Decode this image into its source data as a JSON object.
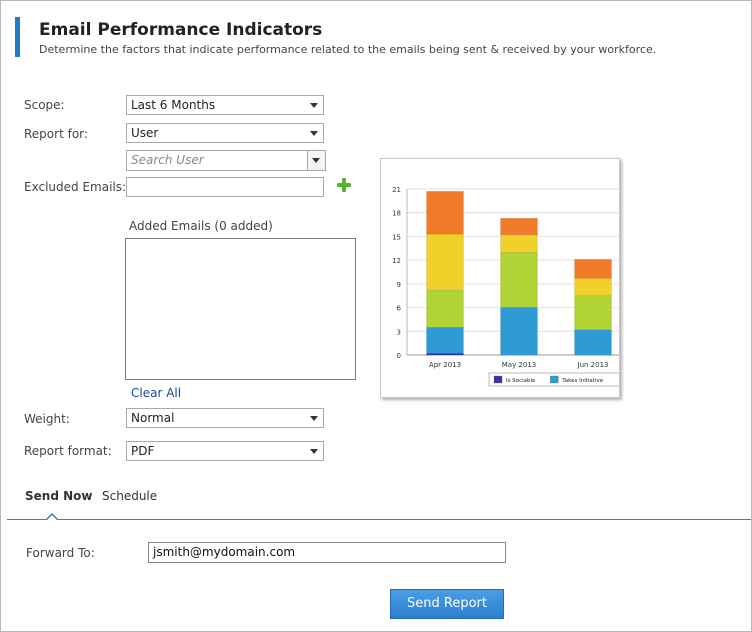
{
  "header": {
    "title": "Email Performance Indicators",
    "subtitle": "Determine the factors that indicate performance related to the emails being sent & received by your workforce."
  },
  "form": {
    "scope": {
      "label": "Scope:",
      "value": "Last 6 Months"
    },
    "report_for": {
      "label": "Report for:",
      "value": "User"
    },
    "search_user": {
      "placeholder": "Search User"
    },
    "excluded_emails": {
      "label": "Excluded Emails:",
      "value": ""
    },
    "added_emails_label": "Added Emails (0 added)",
    "clear_all": "Clear All",
    "weight": {
      "label": "Weight:",
      "value": "Normal"
    },
    "report_format": {
      "label": "Report format:",
      "value": "PDF"
    }
  },
  "tabs": [
    {
      "label": "Send Now",
      "active": true
    },
    {
      "label": "Schedule",
      "active": false
    }
  ],
  "forward": {
    "label": "Forward To:",
    "value": "jsmith@mydomain.com"
  },
  "send_button": "Send Report",
  "chart_data": {
    "type": "bar",
    "stacked": true,
    "categories": [
      "Apr 2013",
      "May 2013",
      "Jun 2013"
    ],
    "ylim": [
      0,
      21
    ],
    "yticks": [
      0,
      3,
      6,
      9,
      12,
      15,
      18,
      21
    ],
    "grid": true,
    "legend_position": "bottom",
    "series": [
      {
        "name": "Is Sociable",
        "color": "#3a2fb0",
        "values": [
          0.2,
          0,
          0
        ]
      },
      {
        "name": "Takes Initiative",
        "color": "#2e9bd6",
        "values": [
          3.3,
          6,
          3.2
        ]
      },
      {
        "color": "#b2d335",
        "values": [
          4.7,
          7,
          4.3
        ]
      },
      {
        "color": "#f2d02b",
        "values": [
          7.1,
          2.2,
          2.2
        ]
      },
      {
        "color": "#f27b2a",
        "values": [
          5.4,
          2.1,
          2.4
        ]
      }
    ]
  },
  "colors": {
    "accent": "#1f7bc6",
    "button": "#2a7fd0",
    "link": "#1a46a8"
  }
}
